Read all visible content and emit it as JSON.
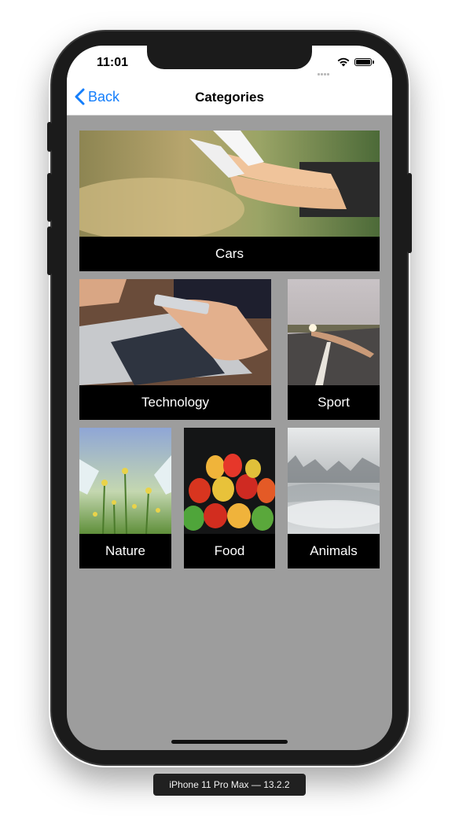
{
  "status_bar": {
    "time": "11:01"
  },
  "nav": {
    "back_label": "Back",
    "title": "Categories"
  },
  "categories": [
    {
      "label": "Cars"
    },
    {
      "label": "Technology"
    },
    {
      "label": "Sport"
    },
    {
      "label": "Nature"
    },
    {
      "label": "Food"
    },
    {
      "label": "Animals"
    }
  ],
  "simulator": {
    "label": "iPhone 11 Pro Max — 13.2.2"
  },
  "colors": {
    "accent": "#147efb",
    "background": "#9d9d9d",
    "label_bar": "#000000"
  }
}
